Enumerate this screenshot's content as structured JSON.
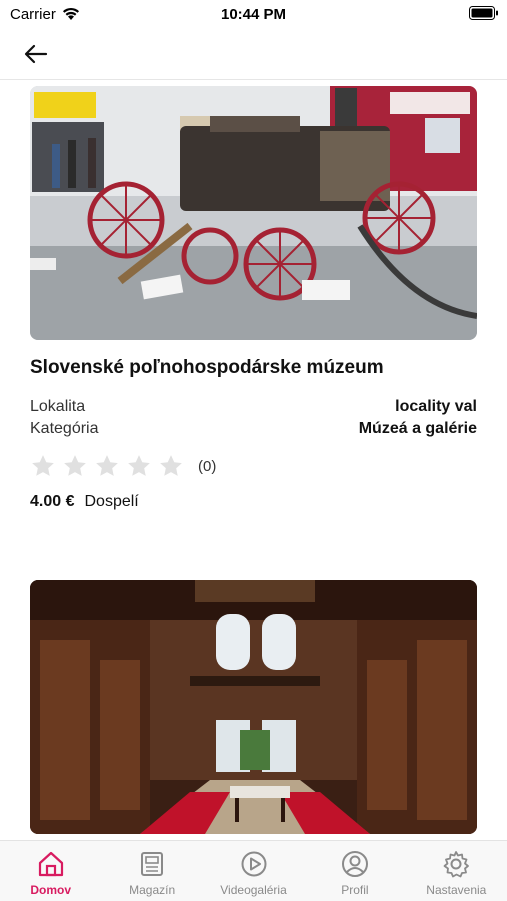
{
  "status": {
    "carrier": "Carrier",
    "time": "10:44 PM"
  },
  "detail": {
    "title": "Slovenské poľnohospodárske múzeum",
    "locality_label": "Lokalita",
    "locality_value": "locality val",
    "category_label": "Kategória",
    "category_value": "Múzeá a galérie",
    "rating_stars": 0,
    "rating_count": "(0)",
    "price": "4.00 €",
    "price_label": "Dospelí"
  },
  "tabs": [
    {
      "label": "Domov",
      "icon": "home-icon",
      "active": true
    },
    {
      "label": "Magazín",
      "icon": "magazine-icon",
      "active": false
    },
    {
      "label": "Videogaléria",
      "icon": "play-icon",
      "active": false
    },
    {
      "label": "Profil",
      "icon": "profile-icon",
      "active": false
    },
    {
      "label": "Nastavenia",
      "icon": "gear-icon",
      "active": false
    }
  ],
  "colors": {
    "accent": "#d81b60",
    "tab_inactive": "#8a8a8a",
    "star_empty": "#e0e0e0"
  }
}
